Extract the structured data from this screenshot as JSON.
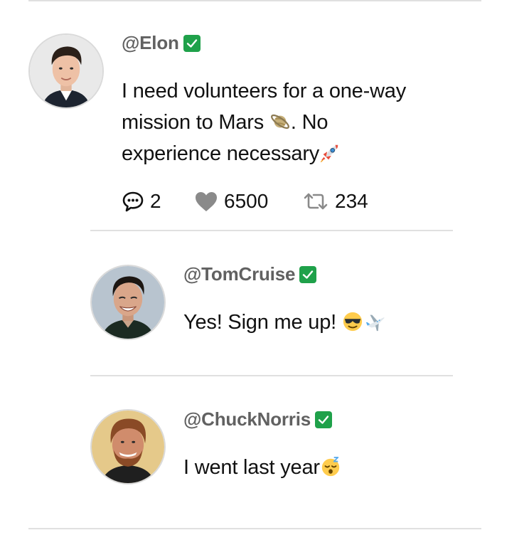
{
  "thread": {
    "main": {
      "handle": "@Elon",
      "verified": true,
      "text_line1": "I need volunteers for a one-way",
      "text_line2_a": "mission to Mars",
      "text_line2_b": ". No",
      "text_line3": "experience necessary",
      "emojis": [
        "ringed-planet-emoji",
        "rocket-emoji"
      ],
      "stats": {
        "comments": "2",
        "likes": "6500",
        "retweets": "234"
      },
      "icons": [
        "comment-icon",
        "heart-icon",
        "retweet-icon"
      ]
    },
    "replies": [
      {
        "handle": "@TomCruise",
        "verified": true,
        "text": "Yes! Sign me up! ",
        "emojis": [
          "sunglasses-face-emoji",
          "airplane-emoji"
        ]
      },
      {
        "handle": "@ChuckNorris",
        "verified": true,
        "text": "I went last year",
        "emojis": [
          "sleeping-face-emoji"
        ]
      }
    ]
  },
  "colors": {
    "handle": "#616161",
    "text": "#111111",
    "divider": "#e0e0e0",
    "verified": "#1fa14a",
    "heart": "#8a8a8a",
    "retweet": "#8a8a8a"
  }
}
